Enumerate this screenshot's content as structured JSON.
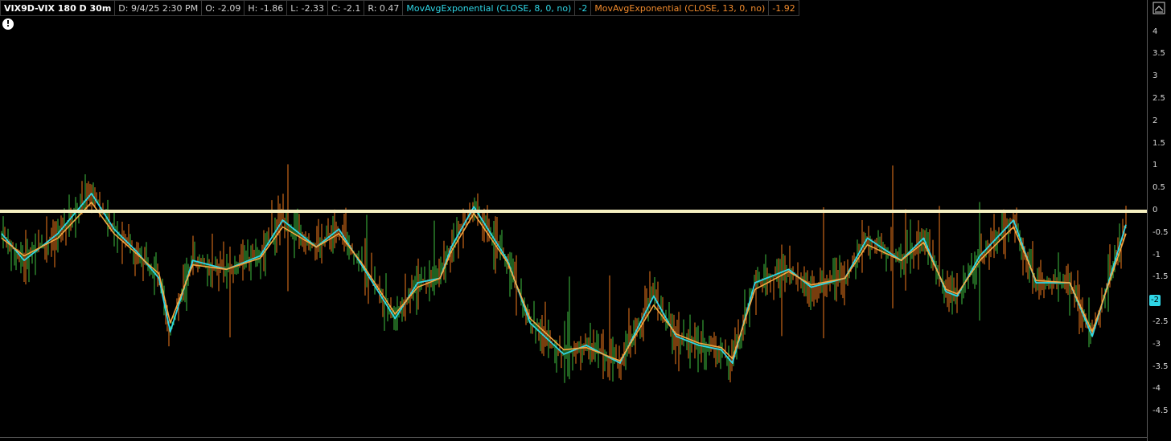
{
  "header": {
    "symbol": "VIX9D-VIX 180 D 30m",
    "date": "D: 9/4/25 2:30 PM",
    "open": "O: -2.09",
    "high": "H: -1.86",
    "low": "L: -2.33",
    "close": "C: -2.1",
    "range": "R: 0.47",
    "ema8_label": "MovAvgExponential (CLOSE, 8, 0, no)",
    "ema8_value": "-2",
    "ema13_label": "MovAvgExponential (CLOSE, 13, 0, no)",
    "ema13_value": "-1.92"
  },
  "alert_icon": "exclamation-icon",
  "last_value_badge": "-2",
  "colors": {
    "background": "#000000",
    "up_bar": "#3fbf3f",
    "down_bar": "#f07a1c",
    "ema8": "#2fd6e6",
    "ema13": "#f5a742",
    "zero_line": "#f5efc0"
  },
  "chart_data": {
    "type": "line",
    "title": "VIX9D-VIX 180 D 30m",
    "y_ticks": [
      "4",
      "3.5",
      "3",
      "2.5",
      "2",
      "1.5",
      "1",
      "0.5",
      "0",
      "-0.5",
      "-1",
      "-1.5",
      "-2",
      "-2.5",
      "-3",
      "-3.5",
      "-4",
      "-4.5"
    ],
    "ylim": [
      -5.1,
      4.35
    ],
    "horizontal_line": 0,
    "grid": false,
    "series": [
      {
        "name": "MovAvgExponential (CLOSE, 8, 0, no)",
        "x": [
          0,
          2,
          5,
          8,
          10,
          12,
          14,
          15,
          17,
          20,
          23,
          25,
          28,
          30,
          32,
          35,
          37,
          39,
          40,
          42,
          45,
          47,
          50,
          52,
          55,
          58,
          60,
          62,
          64,
          65,
          67,
          70,
          72,
          75,
          77,
          80,
          82,
          84,
          85,
          87,
          90,
          92,
          95,
          97,
          100
        ],
        "values": [
          -0.5,
          -1.1,
          -0.5,
          0.4,
          -0.4,
          -0.9,
          -1.5,
          -2.7,
          -1.1,
          -1.3,
          -1.0,
          -0.2,
          -0.8,
          -0.4,
          -1.2,
          -2.4,
          -1.6,
          -1.5,
          -0.8,
          0.1,
          -1.1,
          -2.5,
          -3.2,
          -3.0,
          -3.4,
          -1.9,
          -2.8,
          -3.0,
          -3.1,
          -3.4,
          -1.6,
          -1.3,
          -1.7,
          -1.5,
          -0.6,
          -1.1,
          -0.6,
          -1.8,
          -1.9,
          -1.0,
          -0.2,
          -1.6,
          -1.6,
          -2.8,
          -0.3
        ]
      },
      {
        "name": "MovAvgExponential (CLOSE, 13, 0, no)",
        "x": [
          0,
          2,
          5,
          8,
          10,
          12,
          14,
          15,
          17,
          20,
          23,
          25,
          28,
          30,
          32,
          35,
          37,
          39,
          40,
          42,
          45,
          47,
          50,
          52,
          55,
          58,
          60,
          62,
          64,
          65,
          67,
          70,
          72,
          75,
          77,
          80,
          82,
          84,
          85,
          87,
          90,
          92,
          95,
          97,
          100
        ],
        "values": [
          -0.6,
          -1.0,
          -0.6,
          0.2,
          -0.5,
          -0.95,
          -1.4,
          -2.5,
          -1.2,
          -1.3,
          -1.05,
          -0.35,
          -0.8,
          -0.5,
          -1.15,
          -2.3,
          -1.7,
          -1.5,
          -0.9,
          -0.05,
          -1.15,
          -2.4,
          -3.1,
          -3.05,
          -3.35,
          -2.1,
          -2.75,
          -2.95,
          -3.05,
          -3.3,
          -1.75,
          -1.35,
          -1.65,
          -1.5,
          -0.75,
          -1.1,
          -0.7,
          -1.75,
          -1.85,
          -1.1,
          -0.35,
          -1.55,
          -1.6,
          -2.7,
          -0.5
        ]
      }
    ]
  }
}
